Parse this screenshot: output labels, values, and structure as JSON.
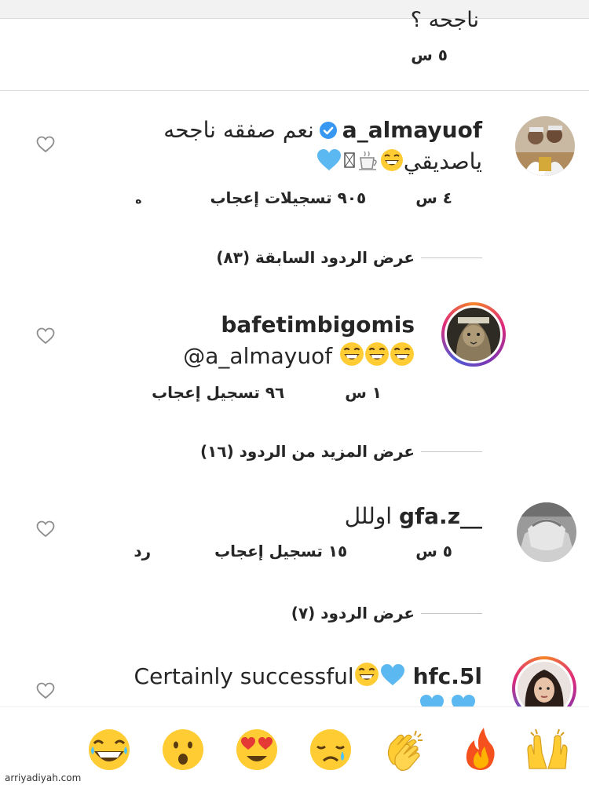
{
  "partial_comment": {
    "text": "ناجحه ؟",
    "time": "٥ س"
  },
  "comments": [
    {
      "username": "a_almayuof",
      "verified": true,
      "text_line1": "نعم صفقه ناجحه",
      "text_line2": "ياصديقي",
      "time": "٤ س",
      "likes": "٩٠٥ تسجيلات إعجاب",
      "reply_fragment": "ه",
      "view_replies": "عرض الردود السابقة (٨٣)"
    },
    {
      "username": "bafetimbigomis",
      "mention": "@a_almayuof",
      "time": "١ س",
      "likes": "٩٦ تسجيل إعجاب",
      "view_replies": "عرض المزيد من الردود (١٦)"
    },
    {
      "username": "gfa.z__",
      "text": "اوللل",
      "time": "٥ س",
      "likes": "١٥ تسجيل إعجاب",
      "reply": "رد",
      "view_replies": "عرض الردود (٧)"
    },
    {
      "username": "hfc.5l",
      "text": "Certainly successful"
    }
  ],
  "reactions": [
    "raising-hands",
    "fire",
    "clapping-hands",
    "crying-face",
    "heart-eyes-face",
    "surprised-face",
    "laughing-face"
  ],
  "watermark": "arriyadiyah.com",
  "colors": {
    "heart_blue": "#5bb8f0",
    "verified_blue": "#3897f0",
    "emoji_yellow": "#ffcc33"
  }
}
